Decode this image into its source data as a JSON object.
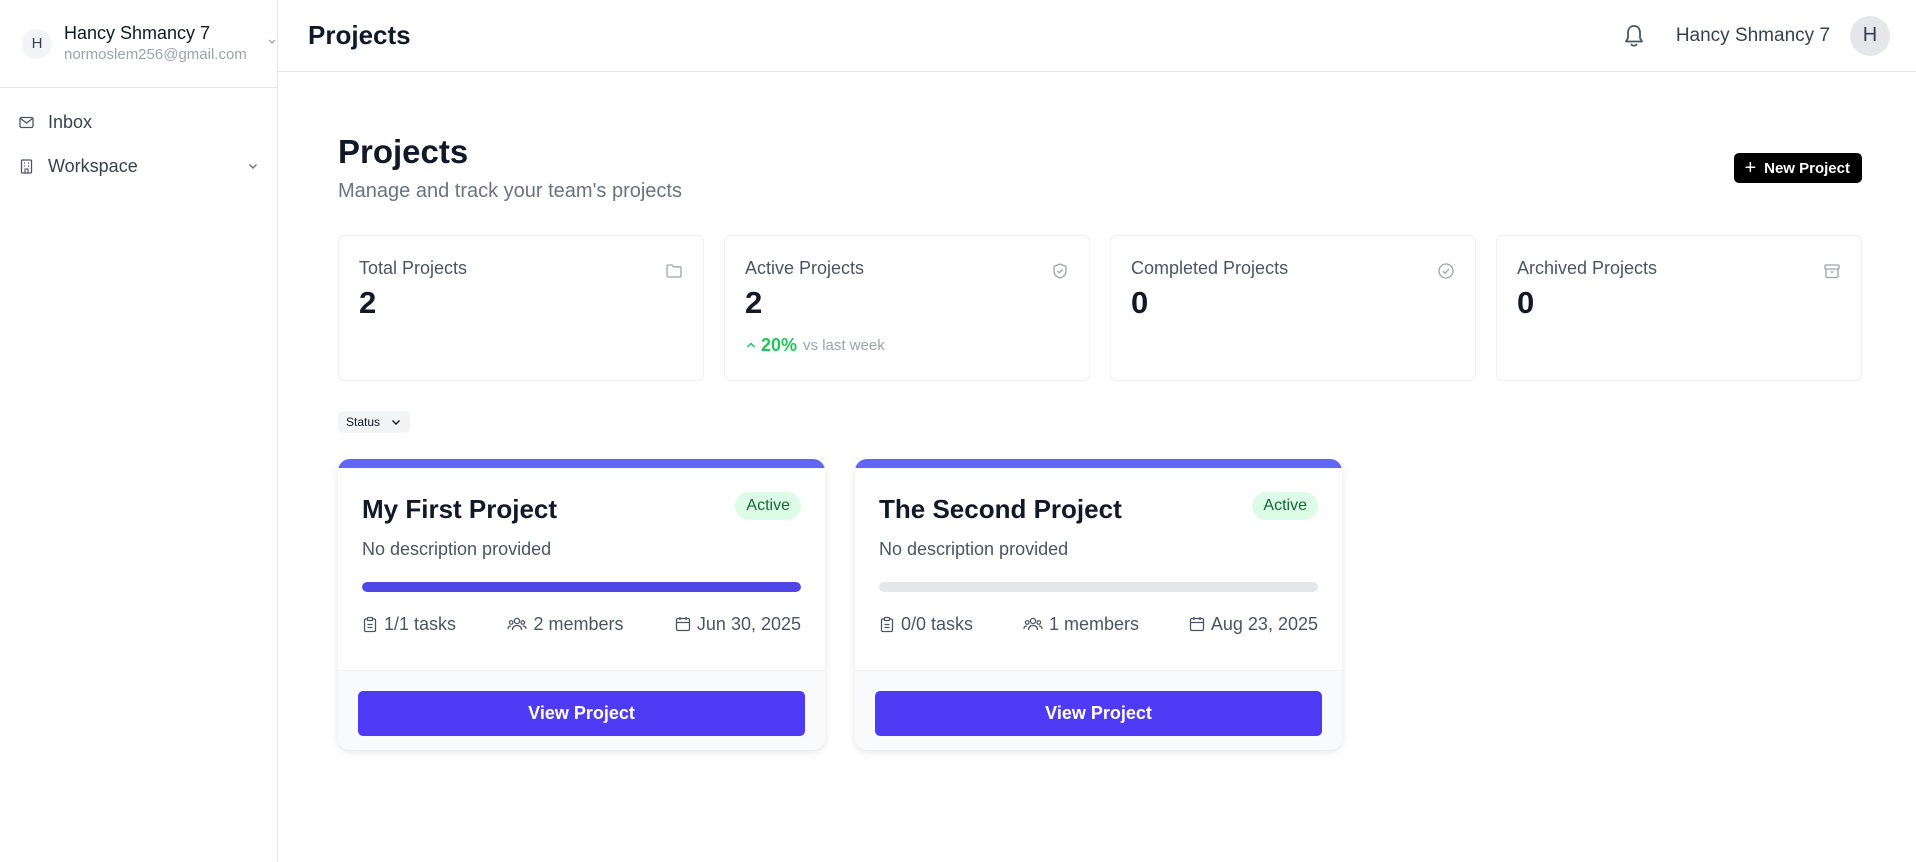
{
  "sidebar": {
    "user": {
      "initial": "H",
      "name": "Hancy Shmancy 7",
      "email": "normoslem256@gmail.com"
    },
    "items": [
      {
        "label": "Inbox",
        "icon": "mail-icon"
      },
      {
        "label": "Workspace",
        "icon": "building-icon"
      }
    ]
  },
  "header": {
    "title": "Projects",
    "user_name": "Hancy Shmancy 7",
    "user_initial": "H"
  },
  "page": {
    "title": "Projects",
    "subtitle": "Manage and track your team's projects",
    "new_button": "New Project"
  },
  "stats": [
    {
      "label": "Total Projects",
      "value": "2",
      "icon": "folder-icon"
    },
    {
      "label": "Active Projects",
      "value": "2",
      "icon": "shield-check-icon",
      "trend_pct": "20%",
      "trend_text": "vs last week"
    },
    {
      "label": "Completed Projects",
      "value": "0",
      "icon": "check-circle-icon"
    },
    {
      "label": "Archived Projects",
      "value": "0",
      "icon": "archive-icon"
    }
  ],
  "filter": {
    "label": "Status"
  },
  "projects": [
    {
      "title": "My First Project",
      "status": "Active",
      "description": "No description provided",
      "progress": 1.0,
      "tasks": "1/1 tasks",
      "members": "2 members",
      "date": "Jun 30, 2025",
      "button": "View Project"
    },
    {
      "title": "The Second Project",
      "status": "Active",
      "description": "No description provided",
      "progress": 0.0,
      "tasks": "0/0 tasks",
      "members": "1 members",
      "date": "Aug 23, 2025",
      "button": "View Project"
    }
  ],
  "colors": {
    "accent": "#4f3bf5",
    "card_bar": "#6366f1",
    "success": "#22c55e",
    "badge_bg": "#dcfce7"
  }
}
